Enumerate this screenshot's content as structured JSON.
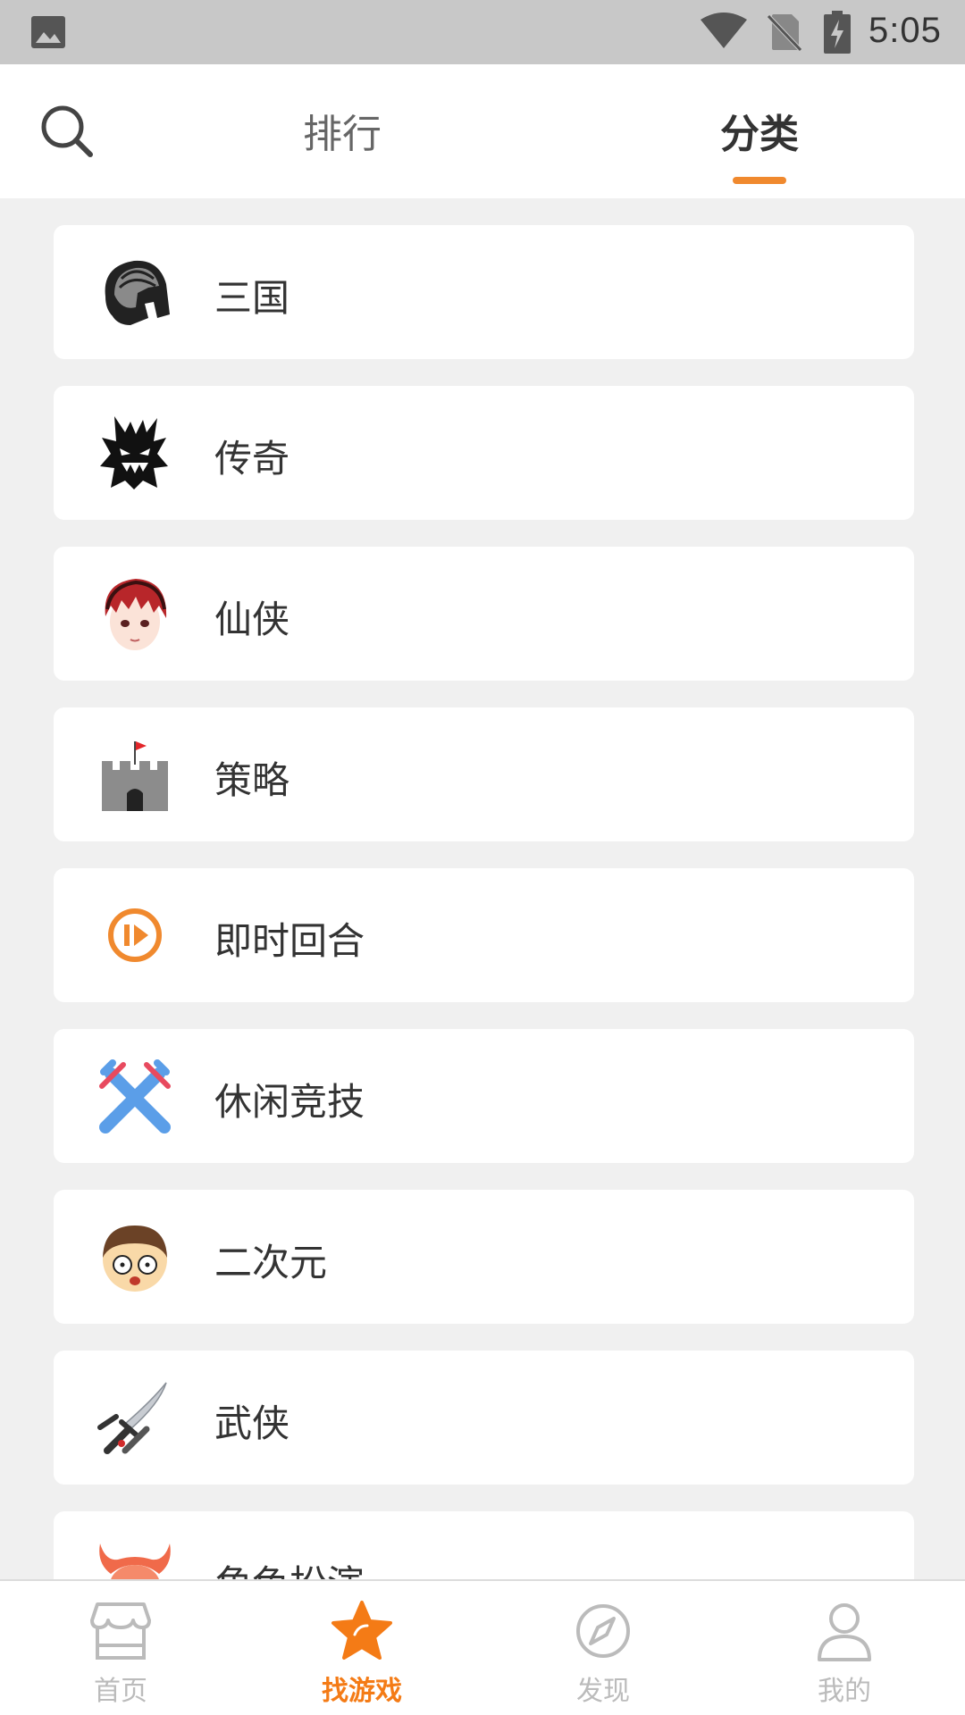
{
  "status_bar": {
    "time": "5:05",
    "icons": [
      "gallery-icon",
      "wifi-icon",
      "no-sim-icon",
      "battery-charging-icon"
    ]
  },
  "header": {
    "search_icon": "search-icon",
    "tabs": [
      {
        "label": "排行",
        "active": false
      },
      {
        "label": "分类",
        "active": true
      }
    ]
  },
  "categories": [
    {
      "label": "三国",
      "icon": "spartan-helmet-icon"
    },
    {
      "label": "传奇",
      "icon": "dark-tree-monster-icon"
    },
    {
      "label": "仙侠",
      "icon": "anime-hero-face-icon"
    },
    {
      "label": "策略",
      "icon": "castle-flag-icon"
    },
    {
      "label": "即时回合",
      "icon": "play-pause-circle-icon"
    },
    {
      "label": "休闲竞技",
      "icon": "crossed-swords-icon"
    },
    {
      "label": "二次元",
      "icon": "cartoon-boy-face-icon"
    },
    {
      "label": "武侠",
      "icon": "katana-sword-icon"
    },
    {
      "label": "角色扮演",
      "icon": "horned-mask-icon"
    }
  ],
  "bottom_nav": [
    {
      "label": "首页",
      "icon": "storefront-icon",
      "active": false
    },
    {
      "label": "找游戏",
      "icon": "star-icon",
      "active": true
    },
    {
      "label": "发现",
      "icon": "compass-icon",
      "active": false
    },
    {
      "label": "我的",
      "icon": "user-icon",
      "active": false
    }
  ],
  "colors": {
    "accent": "#f47b16",
    "tab_underline": "#f0892e",
    "background": "#f0f0f0",
    "status_bar": "#c8c8c8"
  }
}
